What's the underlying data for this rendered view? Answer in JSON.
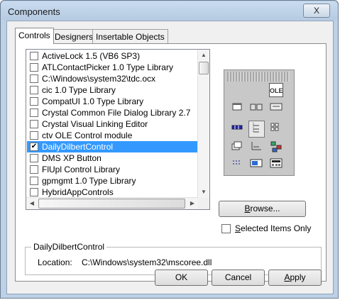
{
  "window": {
    "title": "Components",
    "close_glyph": "X"
  },
  "tabs": [
    {
      "label": "Controls",
      "active": true
    },
    {
      "label": "Designers",
      "active": false
    },
    {
      "label": "Insertable Objects",
      "active": false
    }
  ],
  "list": {
    "items": [
      {
        "label": "ActiveLock 1.5 (VB6 SP3)",
        "checked": false,
        "selected": false
      },
      {
        "label": "ATLContactPicker 1.0 Type Library",
        "checked": false,
        "selected": false
      },
      {
        "label": "C:\\Windows\\system32\\tdc.ocx",
        "checked": false,
        "selected": false
      },
      {
        "label": "cic 1.0 Type Library",
        "checked": false,
        "selected": false
      },
      {
        "label": "CompatUI 1.0 Type Library",
        "checked": false,
        "selected": false
      },
      {
        "label": "Crystal Common File Dialog Library 2.7",
        "checked": false,
        "selected": false
      },
      {
        "label": "Crystal Visual Linking Editor",
        "checked": false,
        "selected": false
      },
      {
        "label": "ctv OLE Control module",
        "checked": false,
        "selected": false
      },
      {
        "label": "DailyDilbertControl",
        "checked": true,
        "selected": true
      },
      {
        "label": "DMS XP Button",
        "checked": false,
        "selected": false
      },
      {
        "label": "FlUpl Control Library",
        "checked": false,
        "selected": false
      },
      {
        "label": "gpmgmt 1.0 Type Library",
        "checked": false,
        "selected": false
      },
      {
        "label": "HybridAppControls",
        "checked": false,
        "selected": false
      }
    ],
    "check_glyph": "✔"
  },
  "toolbox": {
    "tools": [
      "ole-icon",
      "form-icon",
      "buttons-icon",
      "ole-container-icon",
      "ruler-icon",
      "tree-view-icon",
      "grid-icon",
      "frames-icon",
      "chart-icon",
      "network-icon",
      "dotted-grid-icon",
      "image-window-icon",
      "calculator-icon"
    ],
    "ole_label": "OLE"
  },
  "browse_button": {
    "label_pre": "",
    "label_underline": "B",
    "label_post": "rowse..."
  },
  "selected_only": {
    "label_pre": "",
    "label_underline": "S",
    "label_post": "elected Items Only",
    "checked": false
  },
  "info": {
    "group_title": "DailyDilbertControl",
    "location_label": "Location:",
    "location_value": "C:\\Windows\\system32\\mscoree.dll"
  },
  "footer": {
    "ok": "OK",
    "cancel": "Cancel",
    "apply_underline": "A",
    "apply_rest": "pply"
  }
}
